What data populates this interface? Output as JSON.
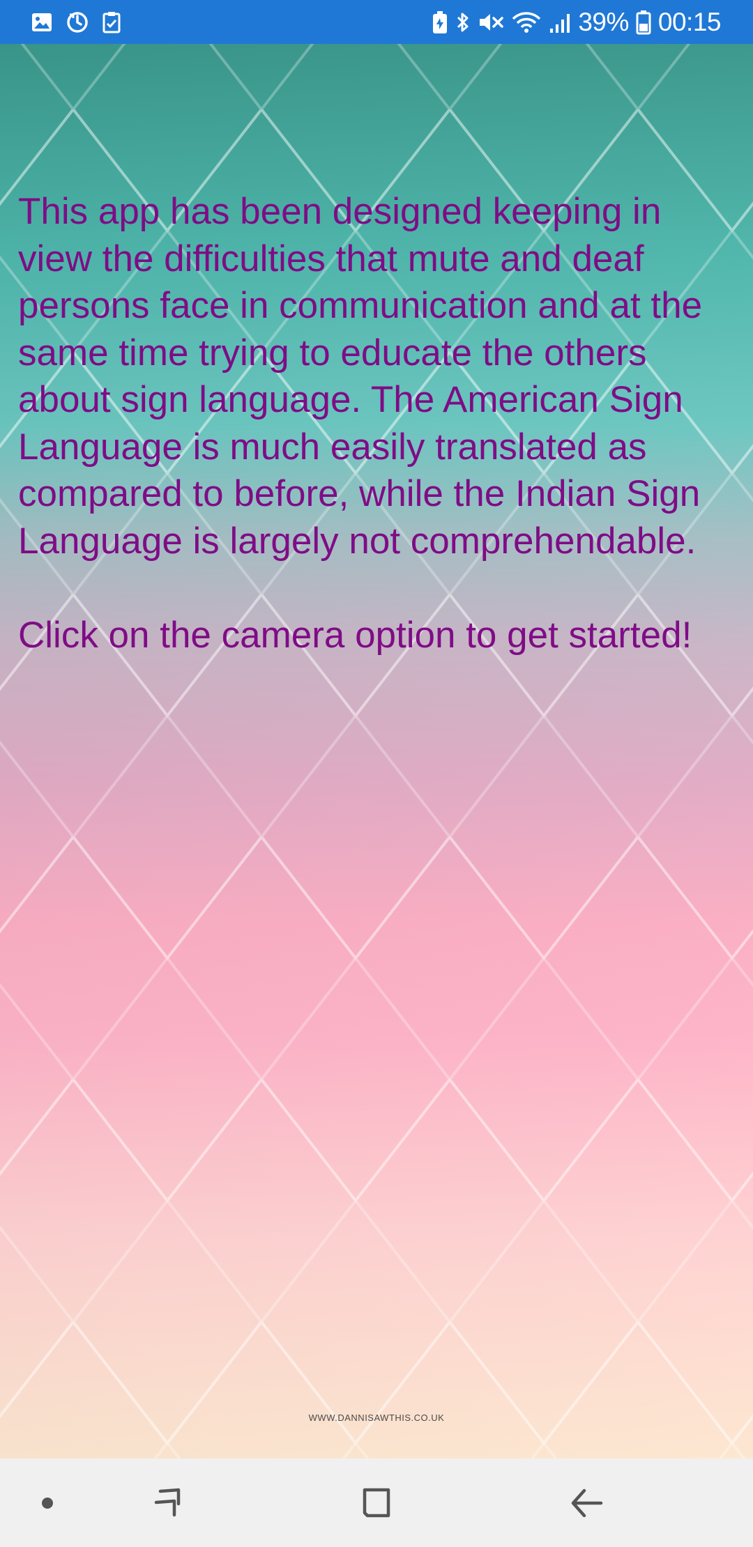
{
  "status_bar": {
    "battery_percent": "39%",
    "time": "00:15",
    "left_icons": [
      "gallery-icon",
      "sync-icon",
      "clipboard-check-icon"
    ],
    "right_icons": [
      "battery-saver-icon",
      "bluetooth-icon",
      "mute-icon",
      "wifi-icon",
      "signal-icon",
      "battery-icon"
    ]
  },
  "main": {
    "description": "This app has been designed keeping in view the difficulties that mute and deaf persons face in communication and at the same time trying to educate the others about sign language. The American Sign Language is much easily translated as compared to before, while the Indian Sign Language is largely not comprehendable.\n\n Click on the camera option to get started!",
    "background_watermark": "WWW.DANNISAWTHIS.CO.UK"
  },
  "nav_bar": {
    "buttons": [
      "dot-icon",
      "recent-apps-icon",
      "home-icon",
      "back-icon"
    ]
  },
  "colors": {
    "status_bar": "#1f78d6",
    "text": "#7f0c86",
    "nav_bar": "#f0f0f0",
    "nav_icon": "#555555"
  }
}
